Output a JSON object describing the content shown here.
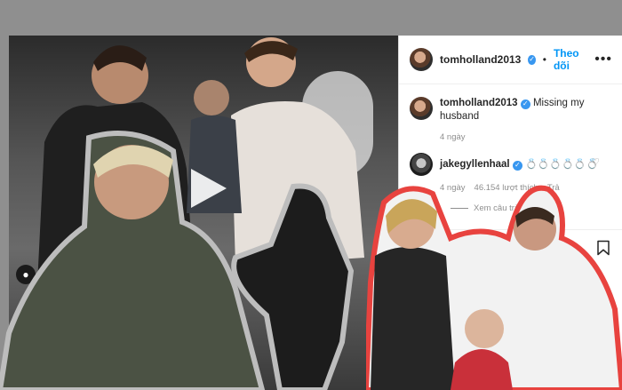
{
  "post": {
    "username": "tomholland2013",
    "follow_label": "Theo dõi",
    "more_label": "•••",
    "caption": "Missing my husband",
    "caption_time": "4 ngày",
    "comment": {
      "username": "jakegyllenhaal",
      "text": "💍💍💍💍💍💍",
      "time": "4 ngày",
      "likes": "46.154 lượt thích",
      "reply_label": "Trả",
      "view_replies": "Xem câu trả lời"
    }
  },
  "colors": {
    "background": "#8f8f8f",
    "link_blue": "#0095f6",
    "verified_blue": "#3897f0",
    "cutout_outline_red": "#e8433f"
  },
  "icons": {
    "share": "share-icon",
    "save": "bookmark-icon",
    "heart": "heart-icon",
    "user_tag": "user-tag-icon",
    "verified": "verified-badge-icon"
  }
}
